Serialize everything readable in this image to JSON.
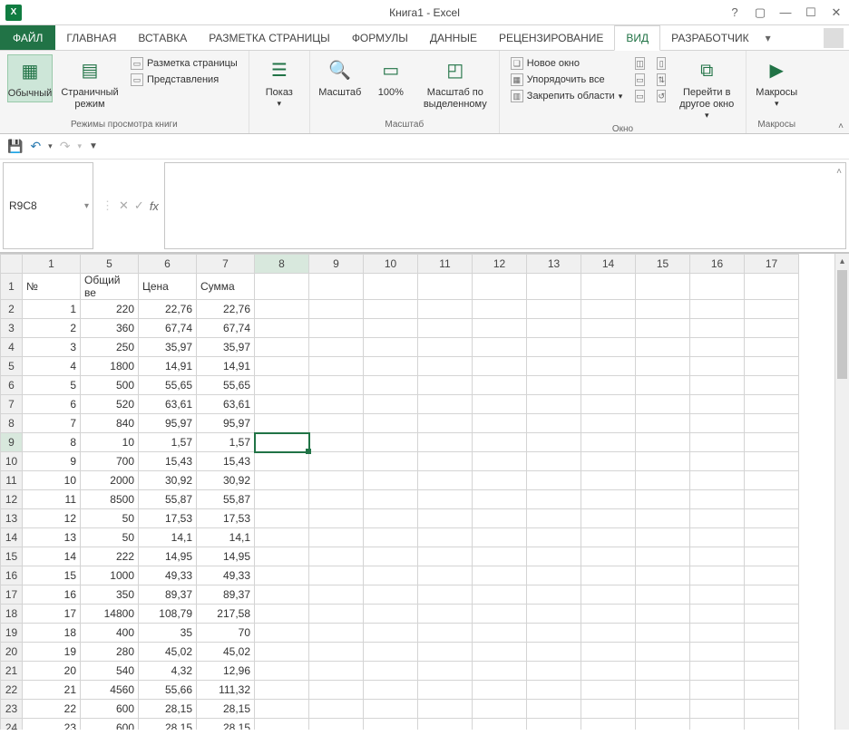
{
  "app": {
    "title": "Книга1 - Excel",
    "icon_text": "X"
  },
  "tabs": {
    "file": "ФАЙЛ",
    "items": [
      "ГЛАВНАЯ",
      "ВСТАВКА",
      "РАЗМЕТКА СТРАНИЦЫ",
      "ФОРМУЛЫ",
      "ДАННЫЕ",
      "РЕЦЕНЗИРОВАНИЕ",
      "ВИД",
      "РАЗРАБОТЧИК"
    ],
    "active_index": 6
  },
  "ribbon": {
    "views": {
      "normal": "Обычный",
      "page_break": "Страничный режим",
      "page_layout": "Разметка страницы",
      "custom_views": "Представления",
      "group_label": "Режимы просмотра книги"
    },
    "show": {
      "label": "Показ"
    },
    "zoom": {
      "zoom": "Масштаб",
      "hundred": "100%",
      "to_selection": "Масштаб по выделенному",
      "group_label": "Масштаб"
    },
    "window": {
      "new_window": "Новое окно",
      "arrange_all": "Упорядочить все",
      "freeze": "Закрепить области",
      "switch": "Перейти в другое окно",
      "group_label": "Окно"
    },
    "macros": {
      "label": "Макросы",
      "group_label": "Макросы"
    }
  },
  "name_box": "R9C8",
  "columns": [
    "1",
    "5",
    "6",
    "7",
    "8",
    "9",
    "10",
    "11",
    "12",
    "13",
    "14",
    "15",
    "16",
    "17"
  ],
  "headers": {
    "c1": "№",
    "c5": "Общий ве",
    "c6": "Цена",
    "c7": "Сумма"
  },
  "rows": [
    {
      "r": "1"
    },
    {
      "r": "2",
      "c1": "1",
      "c5": "220",
      "c6": "22,76",
      "c7": "22,76"
    },
    {
      "r": "3",
      "c1": "2",
      "c5": "360",
      "c6": "67,74",
      "c7": "67,74"
    },
    {
      "r": "4",
      "c1": "3",
      "c5": "250",
      "c6": "35,97",
      "c7": "35,97"
    },
    {
      "r": "5",
      "c1": "4",
      "c5": "1800",
      "c6": "14,91",
      "c7": "14,91"
    },
    {
      "r": "6",
      "c1": "5",
      "c5": "500",
      "c6": "55,65",
      "c7": "55,65"
    },
    {
      "r": "7",
      "c1": "6",
      "c5": "520",
      "c6": "63,61",
      "c7": "63,61"
    },
    {
      "r": "8",
      "c1": "7",
      "c5": "840",
      "c6": "95,97",
      "c7": "95,97"
    },
    {
      "r": "9",
      "c1": "8",
      "c5": "10",
      "c6": "1,57",
      "c7": "1,57"
    },
    {
      "r": "10",
      "c1": "9",
      "c5": "700",
      "c6": "15,43",
      "c7": "15,43"
    },
    {
      "r": "11",
      "c1": "10",
      "c5": "2000",
      "c6": "30,92",
      "c7": "30,92"
    },
    {
      "r": "12",
      "c1": "11",
      "c5": "8500",
      "c6": "55,87",
      "c7": "55,87"
    },
    {
      "r": "13",
      "c1": "12",
      "c5": "50",
      "c6": "17,53",
      "c7": "17,53"
    },
    {
      "r": "14",
      "c1": "13",
      "c5": "50",
      "c6": "14,1",
      "c7": "14,1"
    },
    {
      "r": "15",
      "c1": "14",
      "c5": "222",
      "c6": "14,95",
      "c7": "14,95"
    },
    {
      "r": "16",
      "c1": "15",
      "c5": "1000",
      "c6": "49,33",
      "c7": "49,33"
    },
    {
      "r": "17",
      "c1": "16",
      "c5": "350",
      "c6": "89,37",
      "c7": "89,37"
    },
    {
      "r": "18",
      "c1": "17",
      "c5": "14800",
      "c6": "108,79",
      "c7": "217,58"
    },
    {
      "r": "19",
      "c1": "18",
      "c5": "400",
      "c6": "35",
      "c7": "70"
    },
    {
      "r": "20",
      "c1": "19",
      "c5": "280",
      "c6": "45,02",
      "c7": "45,02"
    },
    {
      "r": "21",
      "c1": "20",
      "c5": "540",
      "c6": "4,32",
      "c7": "12,96"
    },
    {
      "r": "22",
      "c1": "21",
      "c5": "4560",
      "c6": "55,66",
      "c7": "111,32"
    },
    {
      "r": "23",
      "c1": "22",
      "c5": "600",
      "c6": "28,15",
      "c7": "28,15"
    },
    {
      "r": "24",
      "c1": "23",
      "c5": "600",
      "c6": "28,15",
      "c7": "28,15"
    }
  ],
  "selected_row_index": 8,
  "selected_col_index": 4
}
